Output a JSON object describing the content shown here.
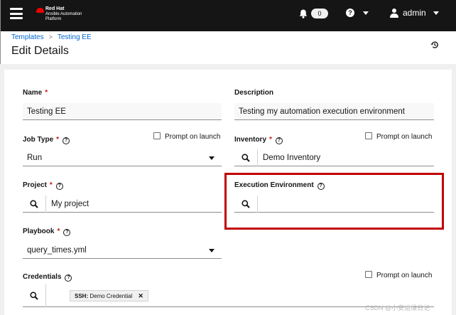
{
  "topbar": {
    "brand_line1": "Red Hat",
    "brand_line2": "Ansible Automation",
    "brand_line3": "Platform",
    "notification_count": "0",
    "user_name": "admin"
  },
  "breadcrumb": {
    "item1": "Templates",
    "item2": "Testing EE"
  },
  "page_title": "Edit Details",
  "form": {
    "name_label": "Name",
    "name_value": "Testing EE",
    "description_label": "Description",
    "description_value": "Testing my automation execution environment",
    "job_type_label": "Job Type",
    "job_type_value": "Run",
    "prompt_label": "Prompt on launch",
    "inventory_label": "Inventory",
    "inventory_value": "Demo Inventory",
    "project_label": "Project",
    "project_value": "My project",
    "ee_label": "Execution Environment",
    "ee_value": "",
    "playbook_label": "Playbook",
    "playbook_value": "query_times.yml",
    "credentials_label": "Credentials",
    "credential_chip_type": "SSH:",
    "credential_chip_name": "Demo Credential"
  },
  "required_mark": "*",
  "help_glyph": "?",
  "remove_glyph": "✕",
  "watermark": "CSDN @小安运维日记",
  "colors": {
    "topbar_bg": "#151515",
    "link": "#0066cc",
    "required": "#c9190b",
    "highlight": "#c00000",
    "brand_red": "#ee0000"
  }
}
